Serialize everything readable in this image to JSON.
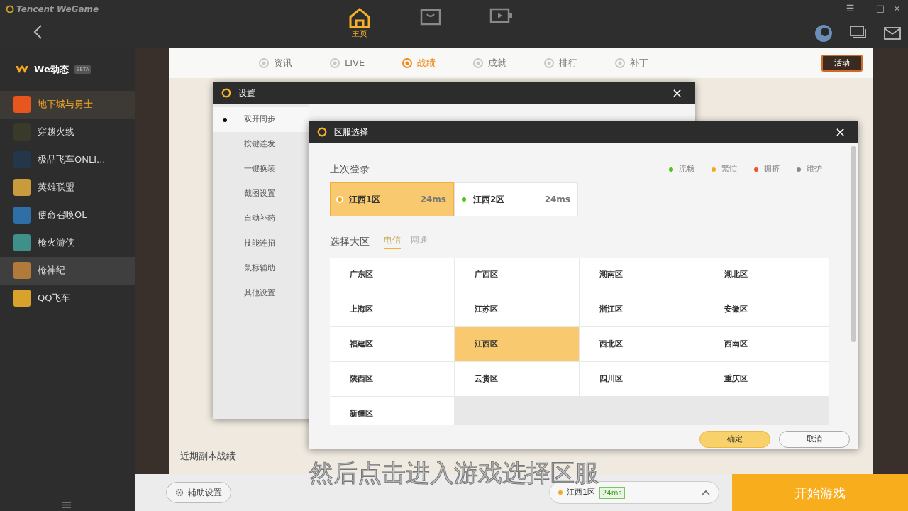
{
  "app": {
    "title": "Tencent WeGame",
    "window_controls": [
      "☰",
      "_",
      "□",
      "×"
    ]
  },
  "top_nav": [
    {
      "kind": "home",
      "label": "主页",
      "selected": true
    },
    {
      "kind": "store",
      "selected": false
    },
    {
      "kind": "video",
      "selected": false
    }
  ],
  "sidebar": {
    "header": "We动态",
    "badge": "BETA",
    "items": [
      {
        "label": "地下城与勇士",
        "color": "#e8561f",
        "selected": true,
        "hovered": false
      },
      {
        "label": "穿越火线",
        "color": "#3a3a2a",
        "selected": false,
        "hovered": false
      },
      {
        "label": "极品飞车ONLI...",
        "color": "#24364a",
        "selected": false,
        "hovered": false
      },
      {
        "label": "英雄联盟",
        "color": "#c89b3c",
        "selected": false,
        "hovered": false
      },
      {
        "label": "使命召唤OL",
        "color": "#2f6fa8",
        "selected": false,
        "hovered": false
      },
      {
        "label": "枪火游侠",
        "color": "#3f8f8a",
        "selected": false,
        "hovered": false
      },
      {
        "label": "枪神纪",
        "color": "#b07a3a",
        "selected": false,
        "hovered": true
      },
      {
        "label": "QQ飞车",
        "color": "#d9a22a",
        "selected": false,
        "hovered": false
      }
    ]
  },
  "game_tabs": [
    {
      "label": "资讯",
      "selected": false
    },
    {
      "label": "LIVE",
      "selected": false
    },
    {
      "label": "战绩",
      "selected": true
    },
    {
      "label": "成就",
      "selected": false
    },
    {
      "label": "排行",
      "selected": false
    },
    {
      "label": "补丁",
      "selected": false
    }
  ],
  "event_badge": "活动",
  "content_heading": "近期副本战绩",
  "settings_dialog": {
    "title": "设置",
    "close": "×",
    "menu": [
      {
        "label": "双开同步",
        "selected": true
      },
      {
        "label": "按键连发",
        "selected": false
      },
      {
        "label": "一键换装",
        "selected": false
      },
      {
        "label": "截图设置",
        "selected": false
      },
      {
        "label": "自动补药",
        "selected": false
      },
      {
        "label": "技能连招",
        "selected": false
      },
      {
        "label": "鼠标辅助",
        "selected": false
      },
      {
        "label": "其他设置",
        "selected": false
      }
    ]
  },
  "region_dialog": {
    "title": "区服选择",
    "close": "×",
    "last_login_label": "上次登录",
    "legend": [
      {
        "label": "流畅",
        "color": "#52c41a"
      },
      {
        "label": "繁忙",
        "color": "#f5a623"
      },
      {
        "label": "拥挤",
        "color": "#f0542d"
      },
      {
        "label": "维护",
        "color": "#888888"
      }
    ],
    "recent": [
      {
        "name": "江西1区",
        "ping": "24ms",
        "color": "#f5a623",
        "selected": true
      },
      {
        "name": "江西2区",
        "ping": "24ms",
        "color": "#52c41a",
        "selected": false
      }
    ],
    "area_label": "选择大区",
    "isp_tabs": [
      {
        "label": "电信",
        "selected": true
      },
      {
        "label": "网通",
        "selected": false
      }
    ],
    "regions": [
      {
        "name": "广东区",
        "selected": false
      },
      {
        "name": "广西区",
        "selected": false
      },
      {
        "name": "湖南区",
        "selected": false
      },
      {
        "name": "湖北区",
        "selected": false
      },
      {
        "name": "上海区",
        "selected": false
      },
      {
        "name": "江苏区",
        "selected": false
      },
      {
        "name": "浙江区",
        "selected": false
      },
      {
        "name": "安徽区",
        "selected": false
      },
      {
        "name": "福建区",
        "selected": false
      },
      {
        "name": "江西区",
        "selected": true
      },
      {
        "name": "西北区",
        "selected": false
      },
      {
        "name": "西南区",
        "selected": false
      },
      {
        "name": "陕西区",
        "selected": false
      },
      {
        "name": "云贵区",
        "selected": false
      },
      {
        "name": "四川区",
        "selected": false
      },
      {
        "name": "重庆区",
        "selected": false
      },
      {
        "name": "新疆区",
        "selected": false
      }
    ],
    "buttons": [
      {
        "label": "确定",
        "kind": "primary"
      },
      {
        "label": "取消",
        "kind": "secondary"
      }
    ]
  },
  "bottom_bar": {
    "helper_button": "辅助设置",
    "server": {
      "name": "江西1区",
      "ping": "24ms",
      "color": "#f5a623"
    },
    "start_button": "开始游戏"
  },
  "caption": "然后点击进入游戏选择区服"
}
